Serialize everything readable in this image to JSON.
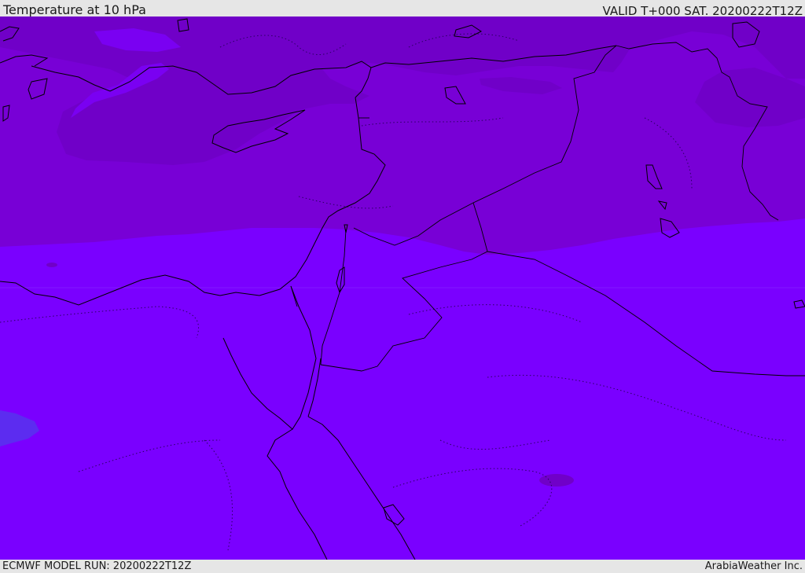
{
  "header": {
    "title": "Temperature at 10 hPa",
    "valid": "VALID T+000 SAT. 20200222T12Z"
  },
  "footer": {
    "model_run": "ECMWF MODEL RUN: 20200222T12Z",
    "credit": "ArabiaWeather Inc."
  },
  "map": {
    "field": "Temperature at 10 hPa",
    "colors": {
      "cold_band": "#7800d6",
      "colder_band": "#7000c8",
      "main_band": "#7a00ff",
      "warm_patch": "#5c2cf0",
      "coastline": "#000000"
    }
  }
}
